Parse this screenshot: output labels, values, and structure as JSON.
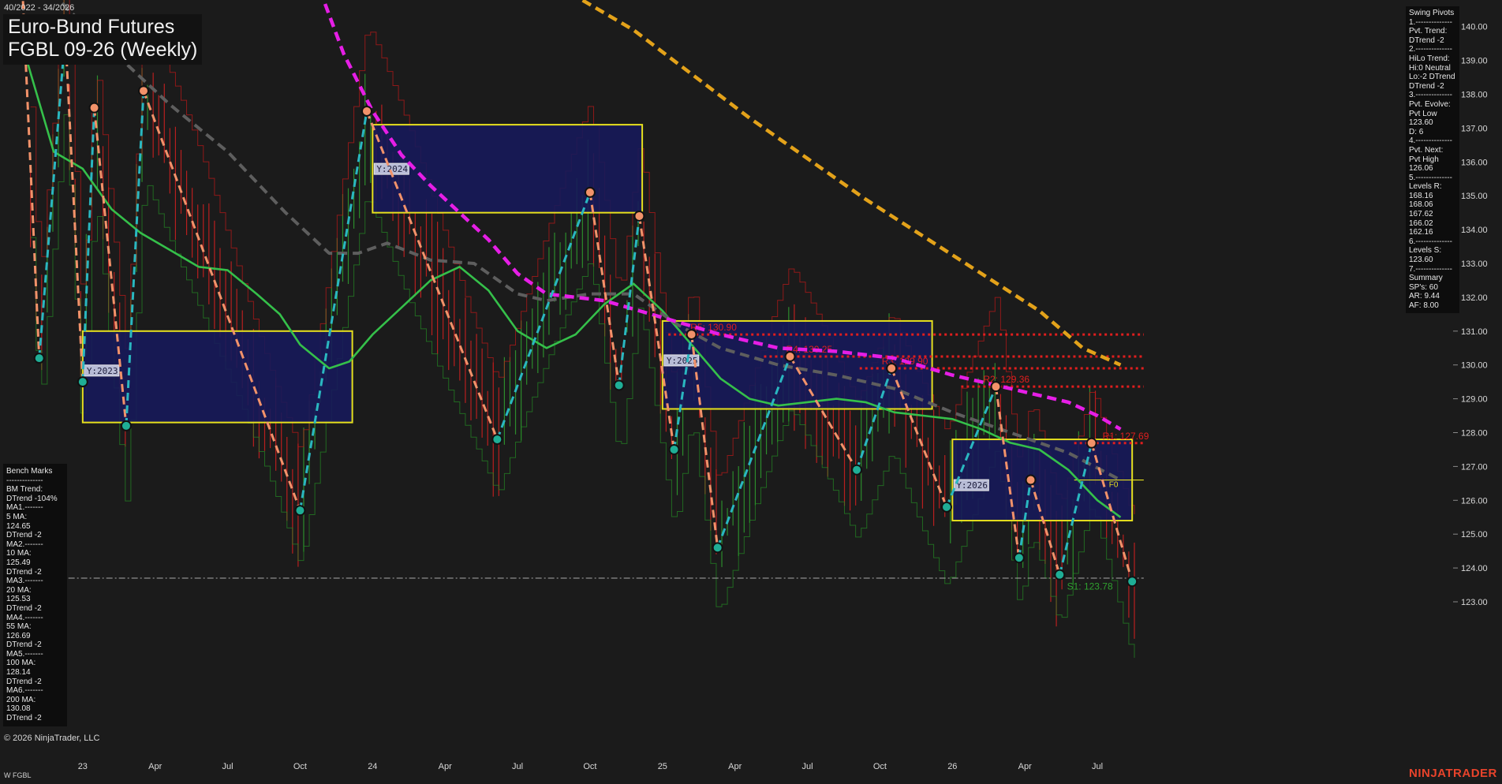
{
  "header": {
    "range": "40/2022 - 34/2026",
    "title_line1": "Euro-Bund Futures",
    "title_line2": "FGBL 09-26 (Weekly)"
  },
  "footer": {
    "copyright": "© 2026 NinjaTrader, LLC",
    "symbol": "W FGBL",
    "brand": "NINJATRADER"
  },
  "benchmarks_panel": [
    "Bench Marks",
    "--------------",
    "BM Trend:",
    "DTrend -104%",
    "MA1.-------",
    "5 MA:",
    "124.65",
    "DTrend -2",
    "MA2.-------",
    "10 MA:",
    "125.49",
    "DTrend -2",
    "MA3.-------",
    "20 MA:",
    "125.53",
    "DTrend -2",
    "MA4.-------",
    "55 MA:",
    "126.69",
    "DTrend -2",
    "MA5.-------",
    "100 MA:",
    "128.14",
    "DTrend -2",
    "MA6.-------",
    "200 MA:",
    "130.08",
    "DTrend -2"
  ],
  "swing_pivots_panel": [
    "Swing Pivots",
    "1.--------------",
    "Pvt. Trend:",
    "DTrend -2",
    "2.--------------",
    "HiLo Trend:",
    "Hi:0 Neutral",
    "Lo:-2 DTrend",
    "DTrend -2",
    "3.--------------",
    "Pvt. Evolve:",
    "Pvt Low",
    "123.60",
    "D: 6",
    "4.--------------",
    "Pvt. Next:",
    "Pvt High",
    "126.06",
    "5.--------------",
    "Levels R:",
    "168.16",
    "168.06",
    "167.62",
    "166.02",
    "162.16",
    "6.--------------",
    "Levels S:",
    "123.60",
    "7.--------------",
    "Summary",
    "SP's: 60",
    "AR: 9.44",
    "AF: 8.00"
  ],
  "colors": {
    "background": "#1b1b1b",
    "up_bar": "#2fa02f",
    "down_bar": "#d42020",
    "swing_up": "#2ab7c0",
    "swing_down": "#f2926a",
    "pivot_low": "#1fae96",
    "pivot_high": "#f2926a",
    "ma_green": "#35c04a",
    "ma_gray": "#5e5e5e",
    "ma_magenta": "#e61ee6",
    "ma_orange": "#e3a21a",
    "year_box_fill": "#171a5a",
    "year_box_stroke": "#e6e01e",
    "resistance": "#e01e1e",
    "support": "#2fa02f"
  },
  "chart_data": {
    "type": "candlestick",
    "title": "Euro-Bund Futures FGBL 09-26 (Weekly)",
    "ylim": [
      122.5,
      140.8
    ],
    "y_ticks": [
      123,
      124,
      125,
      126,
      127,
      128,
      129,
      130,
      131,
      132,
      133,
      134,
      135,
      136,
      137,
      138,
      139,
      140
    ],
    "y_tick_labels": [
      "123.00",
      "124.00",
      "125.00",
      "126.00",
      "127.00",
      "128.00",
      "129.00",
      "130.00",
      "131.00",
      "132.00",
      "133.00",
      "134.00",
      "135.00",
      "136.00",
      "137.00",
      "138.00",
      "139.00",
      "140.00"
    ],
    "x_labels": [
      {
        "t": 2023.0,
        "label": "23"
      },
      {
        "t": 2023.25,
        "label": "Apr"
      },
      {
        "t": 2023.5,
        "label": "Jul"
      },
      {
        "t": 2023.75,
        "label": "Oct"
      },
      {
        "t": 2024.0,
        "label": "24"
      },
      {
        "t": 2024.25,
        "label": "Apr"
      },
      {
        "t": 2024.5,
        "label": "Jul"
      },
      {
        "t": 2024.75,
        "label": "Oct"
      },
      {
        "t": 2025.0,
        "label": "25"
      },
      {
        "t": 2025.25,
        "label": "Apr"
      },
      {
        "t": 2025.5,
        "label": "Jul"
      },
      {
        "t": 2025.75,
        "label": "Oct"
      },
      {
        "t": 2026.0,
        "label": "26"
      },
      {
        "t": 2026.25,
        "label": "Apr"
      },
      {
        "t": 2026.5,
        "label": "Jul"
      }
    ],
    "swing_pivots": [
      {
        "t": 2022.79,
        "v": 141.5,
        "kind": "high"
      },
      {
        "t": 2022.85,
        "v": 130.2,
        "kind": "low"
      },
      {
        "t": 2022.94,
        "v": 139.8,
        "kind": "high"
      },
      {
        "t": 2023.0,
        "v": 129.5,
        "kind": "low"
      },
      {
        "t": 2023.04,
        "v": 137.6,
        "kind": "high"
      },
      {
        "t": 2023.15,
        "v": 128.2,
        "kind": "low"
      },
      {
        "t": 2023.21,
        "v": 138.1,
        "kind": "high"
      },
      {
        "t": 2023.75,
        "v": 125.7,
        "kind": "low"
      },
      {
        "t": 2023.98,
        "v": 137.5,
        "kind": "high"
      },
      {
        "t": 2024.43,
        "v": 127.8,
        "kind": "low"
      },
      {
        "t": 2024.75,
        "v": 135.1,
        "kind": "high"
      },
      {
        "t": 2024.85,
        "v": 129.4,
        "kind": "low"
      },
      {
        "t": 2024.92,
        "v": 134.4,
        "kind": "high"
      },
      {
        "t": 2025.04,
        "v": 127.5,
        "kind": "low"
      },
      {
        "t": 2025.1,
        "v": 130.9,
        "kind": "high"
      },
      {
        "t": 2025.19,
        "v": 124.6,
        "kind": "low"
      },
      {
        "t": 2025.44,
        "v": 130.25,
        "kind": "high"
      },
      {
        "t": 2025.67,
        "v": 126.9,
        "kind": "low"
      },
      {
        "t": 2025.79,
        "v": 129.9,
        "kind": "high"
      },
      {
        "t": 2025.98,
        "v": 125.8,
        "kind": "low"
      },
      {
        "t": 2026.15,
        "v": 129.36,
        "kind": "high"
      },
      {
        "t": 2026.23,
        "v": 124.3,
        "kind": "low"
      },
      {
        "t": 2026.27,
        "v": 126.6,
        "kind": "high"
      },
      {
        "t": 2026.37,
        "v": 123.8,
        "kind": "low"
      },
      {
        "t": 2026.48,
        "v": 127.69,
        "kind": "high"
      },
      {
        "t": 2026.62,
        "v": 123.6,
        "kind": "low"
      }
    ],
    "moving_averages": [
      {
        "name": "MA green",
        "color": "#35c04a",
        "style": "solid",
        "t": [
          2022.79,
          2022.9,
          2023.0,
          2023.1,
          2023.2,
          2023.3,
          2023.4,
          2023.5,
          2023.6,
          2023.68,
          2023.75,
          2023.85,
          2023.92,
          2024.0,
          2024.1,
          2024.2,
          2024.3,
          2024.4,
          2024.5,
          2024.6,
          2024.7,
          2024.8,
          2024.9,
          2025.0,
          2025.1,
          2025.2,
          2025.3,
          2025.4,
          2025.5,
          2025.6,
          2025.7,
          2025.8,
          2025.9,
          2026.0,
          2026.1,
          2026.2,
          2026.3,
          2026.4,
          2026.5,
          2026.58
        ],
        "v": [
          139.5,
          136.3,
          135.8,
          134.6,
          133.9,
          133.4,
          132.9,
          132.8,
          132.1,
          131.5,
          130.6,
          129.9,
          130.1,
          130.9,
          131.7,
          132.5,
          132.9,
          132.2,
          131.0,
          130.5,
          130.9,
          131.8,
          132.4,
          131.6,
          130.6,
          129.6,
          129.0,
          128.8,
          128.9,
          129.0,
          128.9,
          128.6,
          128.5,
          128.4,
          128.1,
          127.7,
          127.5,
          126.9,
          126.0,
          125.5
        ]
      },
      {
        "name": "MA gray",
        "color": "#5e5e5e",
        "style": "dashed",
        "t": [
          2022.79,
          2022.95,
          2023.1,
          2023.3,
          2023.5,
          2023.7,
          2023.85,
          2023.95,
          2024.05,
          2024.2,
          2024.35,
          2024.5,
          2024.6,
          2024.75,
          2024.9,
          2025.05,
          2025.2,
          2025.4,
          2025.6,
          2025.8,
          2026.0,
          2026.2,
          2026.4,
          2026.58
        ],
        "v": [
          142.0,
          140.5,
          139.3,
          137.7,
          136.3,
          134.5,
          133.3,
          133.3,
          133.6,
          133.1,
          133.0,
          132.1,
          131.9,
          132.1,
          132.1,
          131.2,
          130.5,
          130.0,
          129.7,
          129.3,
          128.6,
          128.0,
          127.4,
          126.6
        ]
      },
      {
        "name": "MA magenta",
        "color": "#e61ee6",
        "style": "dashed",
        "t": [
          2023.8,
          2023.9,
          2024.0,
          2024.1,
          2024.2,
          2024.3,
          2024.4,
          2024.5,
          2024.6,
          2024.8,
          2025.0,
          2025.2,
          2025.4,
          2025.6,
          2025.8,
          2026.0,
          2026.1,
          2026.2,
          2026.3,
          2026.4,
          2026.5,
          2026.58
        ],
        "v": [
          141.5,
          139.2,
          137.5,
          136.2,
          135.3,
          134.5,
          133.7,
          132.7,
          132.1,
          131.9,
          131.4,
          130.9,
          130.5,
          130.4,
          130.2,
          129.7,
          129.5,
          129.3,
          129.1,
          128.9,
          128.5,
          128.1
        ]
      },
      {
        "name": "MA orange",
        "color": "#e3a21a",
        "style": "dashed",
        "t": [
          2024.68,
          2024.9,
          2025.1,
          2025.3,
          2025.5,
          2025.7,
          2025.9,
          2026.1,
          2026.3,
          2026.45,
          2026.58
        ],
        "v": [
          141.0,
          139.9,
          138.6,
          137.3,
          136.1,
          134.9,
          133.8,
          132.7,
          131.6,
          130.5,
          130.0
        ]
      }
    ],
    "year_boxes": [
      {
        "label": "Y:2023",
        "t0": 2023.0,
        "t1": 2023.93,
        "v_low": 128.3,
        "v_high": 131.0
      },
      {
        "label": "Y:2024",
        "t0": 2024.0,
        "t1": 2024.93,
        "v_low": 134.5,
        "v_high": 137.1
      },
      {
        "label": "Y:2025",
        "t0": 2025.0,
        "t1": 2025.93,
        "v_low": 128.7,
        "v_high": 131.3
      },
      {
        "label": "Y:2026",
        "t0": 2026.0,
        "t1": 2026.62,
        "v_low": 125.4,
        "v_high": 127.8
      }
    ],
    "resistance_levels": [
      {
        "label": "R5: 130.90",
        "v": 130.9,
        "t0": 2025.02
      },
      {
        "label": "R4: 130.25",
        "v": 130.25,
        "t0": 2025.35
      },
      {
        "label": "R3: 129.90",
        "v": 129.9,
        "t0": 2025.68
      },
      {
        "label": "R2: 129.36",
        "v": 129.36,
        "t0": 2026.03
      },
      {
        "label": "R1: 127.69",
        "v": 127.69,
        "t0": 2026.42
      }
    ],
    "support_levels": [
      {
        "label": "S1: 123.78",
        "v": 123.78,
        "t0": 2026.33
      }
    ],
    "last_price": 123.7,
    "f0_label": "F0",
    "f0_value": 126.6
  }
}
